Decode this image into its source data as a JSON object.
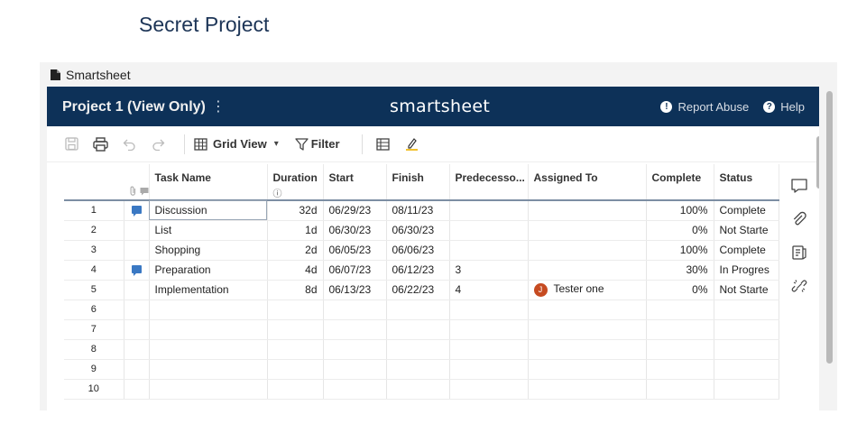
{
  "page": {
    "title": "Secret Project"
  },
  "embed": {
    "label": "Smartsheet"
  },
  "topbar": {
    "sheet_title": "Project 1 (View Only)",
    "kebab": "⋮",
    "brand": "smartsheet",
    "report_abuse": "Report Abuse",
    "help": "Help"
  },
  "toolbar": {
    "view_label": "Grid View",
    "view_caret": "▾",
    "filter_label": "Filter"
  },
  "columns": {
    "task_name": "Task Name",
    "duration": "Duration",
    "start": "Start",
    "finish": "Finish",
    "predecessors": "Predecesso...",
    "assigned_to": "Assigned To",
    "complete": "Complete",
    "status": "Status"
  },
  "rows": [
    {
      "num": "1",
      "comment": true,
      "task": "Discussion",
      "duration": "32d",
      "start": "06/29/23",
      "finish": "08/11/23",
      "pred": "",
      "assigned": "",
      "avatar": "",
      "complete": "100%",
      "status": "Complete"
    },
    {
      "num": "2",
      "comment": false,
      "task": "List",
      "duration": "1d",
      "start": "06/30/23",
      "finish": "06/30/23",
      "pred": "",
      "assigned": "",
      "avatar": "",
      "complete": "0%",
      "status": "Not Starte"
    },
    {
      "num": "3",
      "comment": false,
      "task": "Shopping",
      "duration": "2d",
      "start": "06/05/23",
      "finish": "06/06/23",
      "pred": "",
      "assigned": "",
      "avatar": "",
      "complete": "100%",
      "status": "Complete"
    },
    {
      "num": "4",
      "comment": true,
      "task": "Preparation",
      "duration": "4d",
      "start": "06/07/23",
      "finish": "06/12/23",
      "pred": "3",
      "assigned": "",
      "avatar": "",
      "complete": "30%",
      "status": "In Progres"
    },
    {
      "num": "5",
      "comment": false,
      "task": "Implementation",
      "duration": "8d",
      "start": "06/13/23",
      "finish": "06/22/23",
      "pred": "4",
      "assigned": "Tester one",
      "avatar": "J",
      "complete": "0%",
      "status": "Not Starte"
    },
    {
      "num": "6"
    },
    {
      "num": "7"
    },
    {
      "num": "8"
    },
    {
      "num": "9"
    },
    {
      "num": "10"
    }
  ],
  "colors": {
    "topbar_bg": "#0d3158",
    "title_blue": "#1d3557",
    "comment_blue": "#3a78c3",
    "avatar_bg": "#c64b21"
  }
}
